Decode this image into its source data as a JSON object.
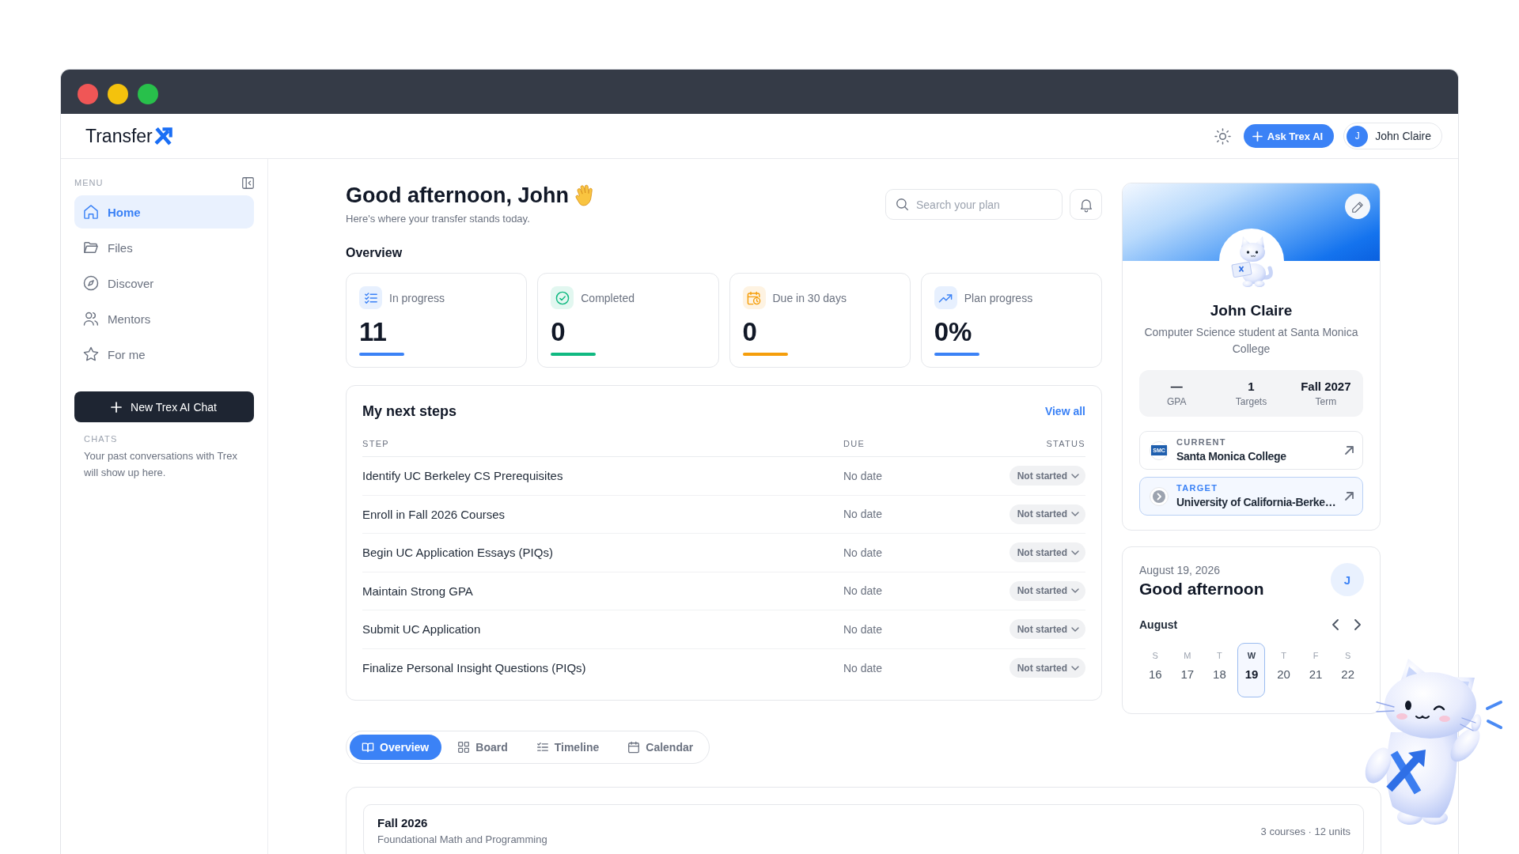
{
  "header": {
    "logo": "Transfer",
    "ask_button": "Ask Trex AI",
    "user": {
      "initial": "J",
      "name": "John Claire"
    }
  },
  "sidebar": {
    "menu_label": "MENU",
    "items": [
      {
        "label": "Home",
        "selected": true
      },
      {
        "label": "Files",
        "selected": false
      },
      {
        "label": "Discover",
        "selected": false
      },
      {
        "label": "Mentors",
        "selected": false
      },
      {
        "label": "For me",
        "selected": false
      }
    ],
    "new_chat_button": "New Trex AI Chat",
    "chats_label": "CHATS",
    "chats_empty": "Your past conversations with Trex will show up here."
  },
  "greeting": {
    "title": "Good afternoon, John",
    "subtitle": "Here's where your transfer stands today."
  },
  "search": {
    "placeholder": "Search your plan"
  },
  "overview": {
    "title": "Overview",
    "stats": [
      {
        "label": "In progress",
        "value": "11",
        "color": "#3b82f6"
      },
      {
        "label": "Completed",
        "value": "0",
        "color": "#10b981"
      },
      {
        "label": "Due in 30 days",
        "value": "0",
        "color": "#f59e0b"
      },
      {
        "label": "Plan progress",
        "value": "0%",
        "color": "#3b82f6"
      }
    ]
  },
  "next_steps": {
    "title": "My next steps",
    "view_all": "View all",
    "columns": [
      "STEP",
      "DUE",
      "STATUS"
    ],
    "rows": [
      {
        "step": "Identify UC Berkeley CS Prerequisites",
        "due": "No date",
        "status": "Not started"
      },
      {
        "step": "Enroll in Fall 2026 Courses",
        "due": "No date",
        "status": "Not started"
      },
      {
        "step": "Begin UC Application Essays (PIQs)",
        "due": "No date",
        "status": "Not started"
      },
      {
        "step": "Maintain Strong GPA",
        "due": "No date",
        "status": "Not started"
      },
      {
        "step": "Submit UC Application",
        "due": "No date",
        "status": "Not started"
      },
      {
        "step": "Finalize Personal Insight Questions (PIQs)",
        "due": "No date",
        "status": "Not started"
      }
    ]
  },
  "profile": {
    "name": "John Claire",
    "description": "Computer Science student at Santa Monica College",
    "stats": [
      {
        "value": "—",
        "label": "GPA"
      },
      {
        "value": "1",
        "label": "Targets"
      },
      {
        "value": "Fall 2027",
        "label": "Term"
      }
    ],
    "schools": [
      {
        "kind": "current",
        "label": "CURRENT",
        "name": "Santa Monica College",
        "logo": "SMC"
      },
      {
        "kind": "target",
        "label": "TARGET",
        "name": "University of California-Berke…"
      }
    ]
  },
  "calendar": {
    "date": "August 19, 2026",
    "greeting": "Good afternoon",
    "initial": "J",
    "month": "August",
    "days": [
      {
        "weekday": "S",
        "day": "16",
        "selected": false
      },
      {
        "weekday": "M",
        "day": "17",
        "selected": false
      },
      {
        "weekday": "T",
        "day": "18",
        "selected": false
      },
      {
        "weekday": "W",
        "day": "19",
        "selected": true
      },
      {
        "weekday": "T",
        "day": "20",
        "selected": false
      },
      {
        "weekday": "F",
        "day": "21",
        "selected": false
      },
      {
        "weekday": "S",
        "day": "22",
        "selected": false
      }
    ]
  },
  "view_tabs": [
    {
      "label": "Overview",
      "selected": true
    },
    {
      "label": "Board",
      "selected": false
    },
    {
      "label": "Timeline",
      "selected": false
    },
    {
      "label": "Calendar",
      "selected": false
    }
  ],
  "terms": [
    {
      "title": "Fall 2026",
      "subtitle": "Foundational Math and Programming",
      "summary": "3 courses · 12 units"
    }
  ]
}
